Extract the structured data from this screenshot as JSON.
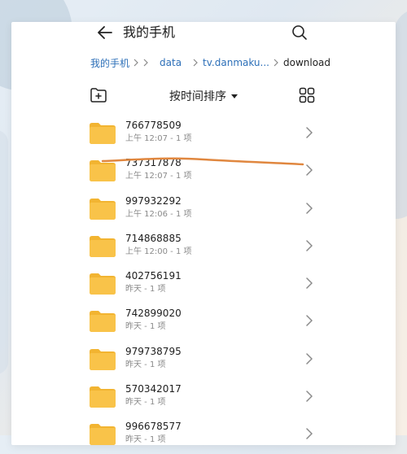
{
  "header": {
    "title": "我的手机"
  },
  "breadcrumb": {
    "items": [
      {
        "label": "我的手机"
      },
      {
        "label": "data"
      },
      {
        "label": "tv.danmaku..."
      },
      {
        "label": "download"
      }
    ]
  },
  "toolbar": {
    "sort_label": "按时间排序"
  },
  "files": [
    {
      "name": "766778509",
      "meta": "上午 12:07 - 1 项"
    },
    {
      "name": "737317878",
      "meta": "上午 12:07 - 1 项"
    },
    {
      "name": "997932292",
      "meta": "上午 12:06 - 1 项"
    },
    {
      "name": "714868885",
      "meta": "上午 12:00 - 1 项"
    },
    {
      "name": "402756191",
      "meta": "昨天 - 1 项"
    },
    {
      "name": "742899020",
      "meta": "昨天 - 1 项"
    },
    {
      "name": "979738795",
      "meta": "昨天 - 1 项"
    },
    {
      "name": "570342017",
      "meta": "昨天 - 1 项"
    },
    {
      "name": "996678577",
      "meta": "昨天 - 1 项"
    }
  ],
  "colors": {
    "folder": "#f9c349",
    "link": "#2c6fb8",
    "annotation_stroke": "#e0873f"
  },
  "icons": {
    "back": "arrow-left-icon",
    "search": "search-icon",
    "new_folder": "new-folder-icon",
    "grid": "grid-view-icon",
    "chevron": "chevron-right-icon",
    "folder": "folder-icon"
  }
}
